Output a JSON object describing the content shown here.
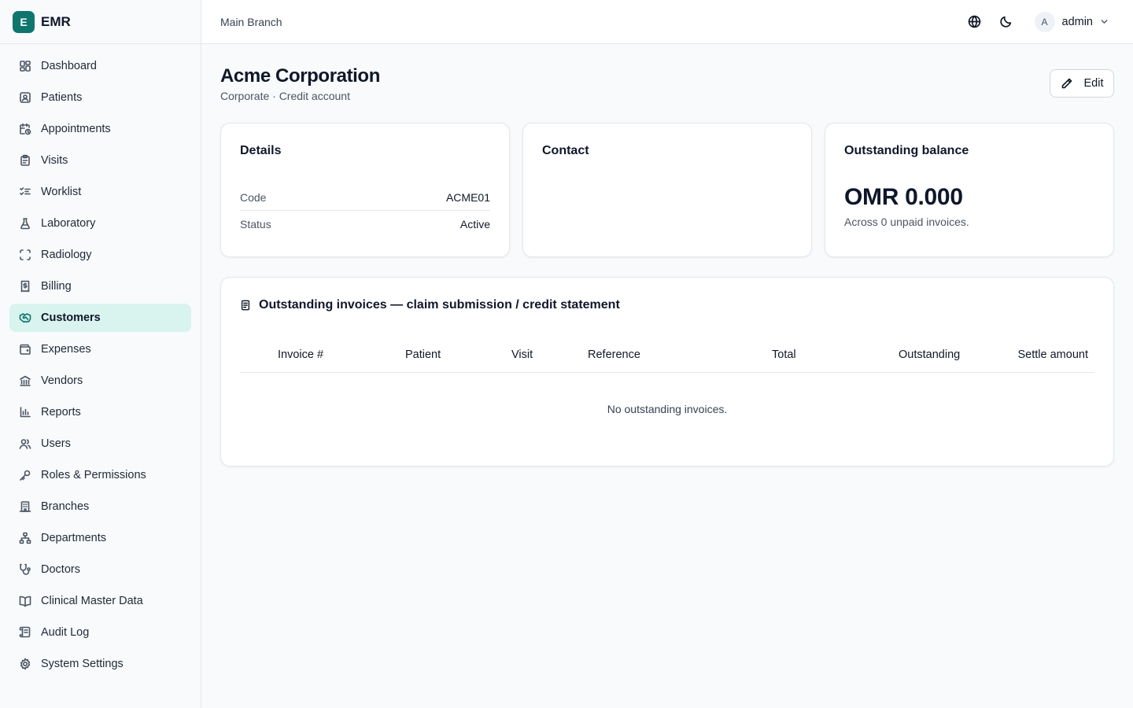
{
  "brand": {
    "logo_letter": "E",
    "name": "EMR"
  },
  "sidebar": {
    "items": [
      {
        "label": "Dashboard",
        "icon": "dashboard-icon"
      },
      {
        "label": "Patients",
        "icon": "patients-icon"
      },
      {
        "label": "Appointments",
        "icon": "calendar-clock-icon"
      },
      {
        "label": "Visits",
        "icon": "clipboard-icon"
      },
      {
        "label": "Worklist",
        "icon": "list-checks-icon"
      },
      {
        "label": "Laboratory",
        "icon": "flask-icon"
      },
      {
        "label": "Radiology",
        "icon": "scan-icon"
      },
      {
        "label": "Billing",
        "icon": "receipt-icon"
      },
      {
        "label": "Customers",
        "icon": "handshake-icon",
        "active": true
      },
      {
        "label": "Expenses",
        "icon": "wallet-icon"
      },
      {
        "label": "Vendors",
        "icon": "landmark-icon"
      },
      {
        "label": "Reports",
        "icon": "bar-chart-icon"
      },
      {
        "label": "Users",
        "icon": "users-icon"
      },
      {
        "label": "Roles & Permissions",
        "icon": "key-icon"
      },
      {
        "label": "Branches",
        "icon": "building-icon"
      },
      {
        "label": "Departments",
        "icon": "network-icon"
      },
      {
        "label": "Doctors",
        "icon": "stethoscope-icon"
      },
      {
        "label": "Clinical Master Data",
        "icon": "book-icon"
      },
      {
        "label": "Audit Log",
        "icon": "scroll-icon"
      },
      {
        "label": "System Settings",
        "icon": "gear-icon"
      }
    ]
  },
  "header": {
    "branch": "Main Branch",
    "user": {
      "avatar_letter": "A",
      "name": "admin"
    }
  },
  "page": {
    "title": "Acme Corporation",
    "subtitle": "Corporate · Credit account",
    "edit_label": "Edit"
  },
  "details": {
    "title": "Details",
    "rows": [
      {
        "key": "Code",
        "value": "ACME01"
      },
      {
        "key": "Status",
        "value": "Active"
      }
    ]
  },
  "contact": {
    "title": "Contact"
  },
  "balance": {
    "title": "Outstanding balance",
    "amount": "OMR 0.000",
    "note": "Across 0 unpaid invoices."
  },
  "invoices": {
    "title": "Outstanding invoices — claim submission / credit statement",
    "columns": [
      "Invoice #",
      "Patient",
      "Visit",
      "Reference",
      "Total",
      "Outstanding",
      "Settle amount"
    ],
    "empty_text": "No outstanding invoices."
  },
  "colors": {
    "brand": "#0f766e",
    "active_nav_bg": "#d9f3ee"
  }
}
